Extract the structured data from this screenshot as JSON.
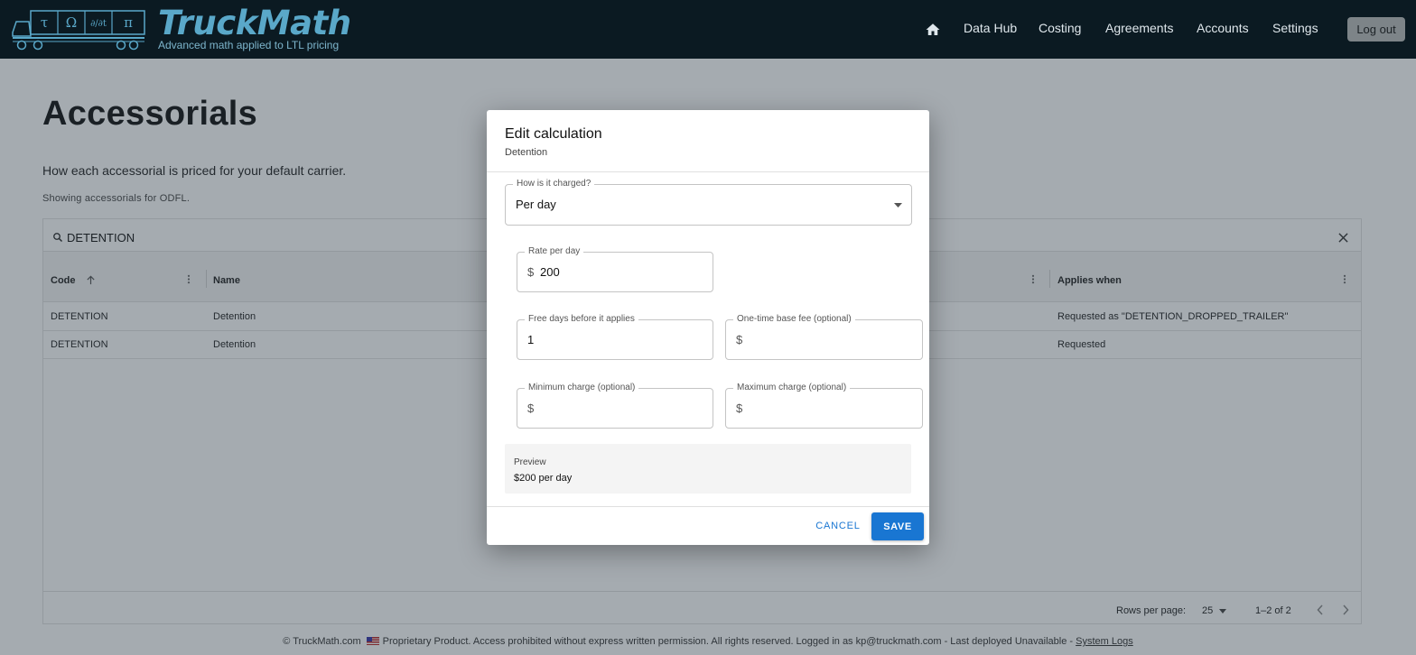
{
  "header": {
    "logo_word": "TruckMath",
    "logo_tagline": "Advanced math applied to LTL pricing",
    "logo_symbols": [
      "τ",
      "Ω",
      "∂/∂t",
      "π"
    ],
    "nav": [
      "Data Hub",
      "Costing",
      "Agreements",
      "Accounts",
      "Settings"
    ],
    "logout_label": "Log out"
  },
  "page": {
    "title": "Accessorials",
    "description": "How each accessorial is priced for your default carrier.",
    "subtitle": "Showing accessorials for ODFL."
  },
  "grid": {
    "search_value": "DETENTION",
    "columns": [
      "Code",
      "Name",
      "Applies when"
    ],
    "rows": [
      {
        "code": "DETENTION",
        "name": "Detention",
        "applies_when": "Requested as \"DETENTION_DROPPED_TRAILER\""
      },
      {
        "code": "DETENTION",
        "name": "Detention",
        "applies_when": "Requested"
      }
    ],
    "footer": {
      "rows_per_page_label": "Rows per page:",
      "rows_per_page_value": "25",
      "range": "1–2 of 2"
    }
  },
  "footer": {
    "copyright": "© TruckMath.com",
    "text": "Proprietary Product. Access prohibited without express written permission. All rights reserved. Logged in as kp@truckmath.com - Last deployed Unavailable -",
    "system_logs": "System Logs"
  },
  "dialog": {
    "title": "Edit calculation",
    "subtitle": "Detention",
    "charge_type": {
      "label": "How is it charged?",
      "value": "Per day"
    },
    "rate": {
      "label": "Rate per day",
      "prefix": "$",
      "value": "200"
    },
    "free_days": {
      "label": "Free days before it applies",
      "value": "1"
    },
    "base_fee": {
      "label": "One-time base fee (optional)",
      "prefix": "$",
      "value": ""
    },
    "min_charge": {
      "label": "Minimum charge (optional)",
      "prefix": "$",
      "value": ""
    },
    "max_charge": {
      "label": "Maximum charge (optional)",
      "prefix": "$",
      "value": ""
    },
    "preview": {
      "label": "Preview",
      "text": "$200 per day"
    },
    "cancel_label": "CANCEL",
    "save_label": "SAVE"
  },
  "colors": {
    "header_bg": "#0b1a22",
    "brand": "#5aa8c9",
    "primary": "#1976d2"
  }
}
